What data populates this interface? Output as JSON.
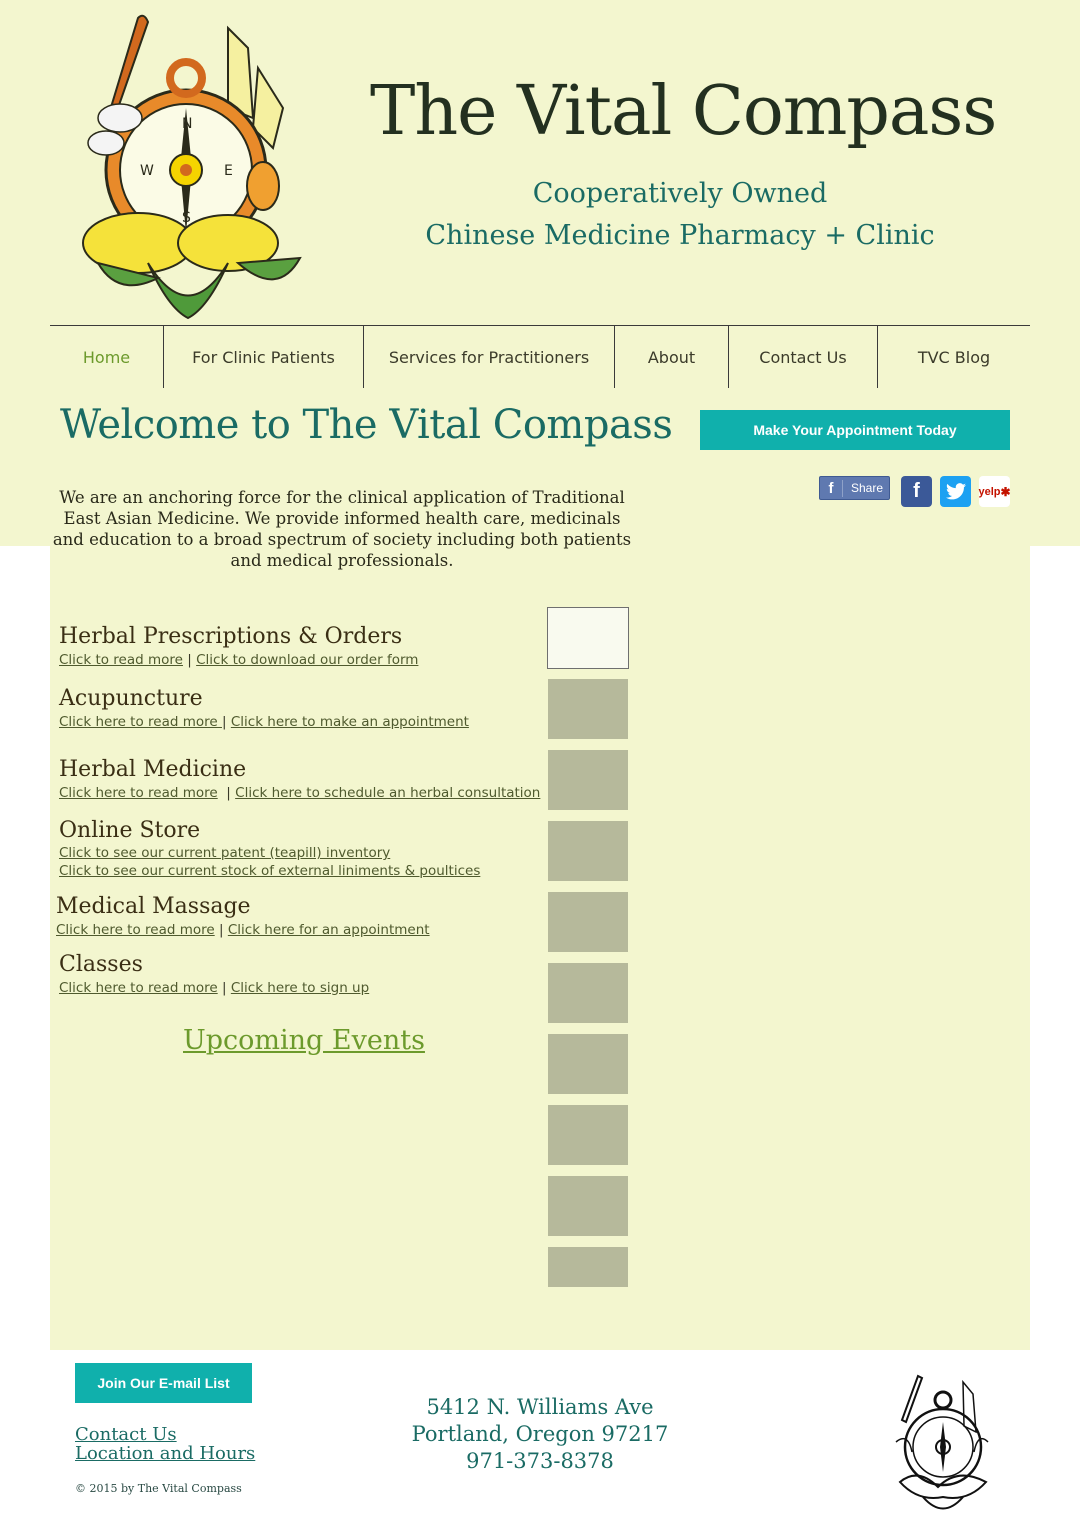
{
  "header": {
    "title": "The Vital Compass",
    "tagline_1": "Cooperatively Owned",
    "tagline_2": "Chinese Medicine Pharmacy + Clinic"
  },
  "nav": {
    "items": [
      {
        "label": "Home",
        "active": true
      },
      {
        "label": "For Clinic Patients"
      },
      {
        "label": "Services for Practitioners"
      },
      {
        "label": "About"
      },
      {
        "label": "Contact Us"
      },
      {
        "label": "TVC Blog"
      }
    ]
  },
  "main": {
    "welcome": "Welcome to The Vital Compass",
    "appointment_button": "Make Your Appointment Today",
    "intro": "We are an anchoring force for the clinical application of Traditional East Asian Medicine. We provide informed health care, medicinals and education to a broad spectrum of society including both patients and medical professionals.",
    "social": {
      "share_label": "Share",
      "yelp_label": "yelp"
    },
    "services": [
      {
        "title": "Herbal Prescriptions & Orders",
        "links": [
          "Click to read more",
          "Click to download our order form"
        ]
      },
      {
        "title": "Acupuncture",
        "links": [
          "Click here to read more ",
          "Click here to make an appointment"
        ]
      },
      {
        "title": "Herbal Medicine",
        "links": [
          "Click here to read more",
          "Click here to schedule an herbal consultation"
        ]
      },
      {
        "title": "Online Store",
        "links": [
          "Click to see our current patent (teapill) inventory",
          "Click to see our current stock of external liniments & poultices"
        ]
      },
      {
        "title": "Medical Massage",
        "links": [
          "Click here to read more",
          "Click here for an appointment"
        ]
      },
      {
        "title": "Classes",
        "links": [
          "Click here to read more",
          "Click here to sign up"
        ]
      }
    ],
    "events_link": "Upcoming Events",
    "separator": "|"
  },
  "footer": {
    "email_button": "Join Our E-mail List",
    "contact_link": "Contact Us",
    "location_link": "Location and Hours",
    "copyright": "© 2015 by The Vital Compass",
    "address_line1": "5412 N. Williams Ave",
    "address_line2": "Portland, Oregon 97217",
    "phone": "971-373-8378"
  },
  "colors": {
    "background": "#f3f6cf",
    "teal": "#1a6b64",
    "button": "#10b0ac",
    "active_nav": "#6c9a2c",
    "thumb": "#b6b99b"
  }
}
